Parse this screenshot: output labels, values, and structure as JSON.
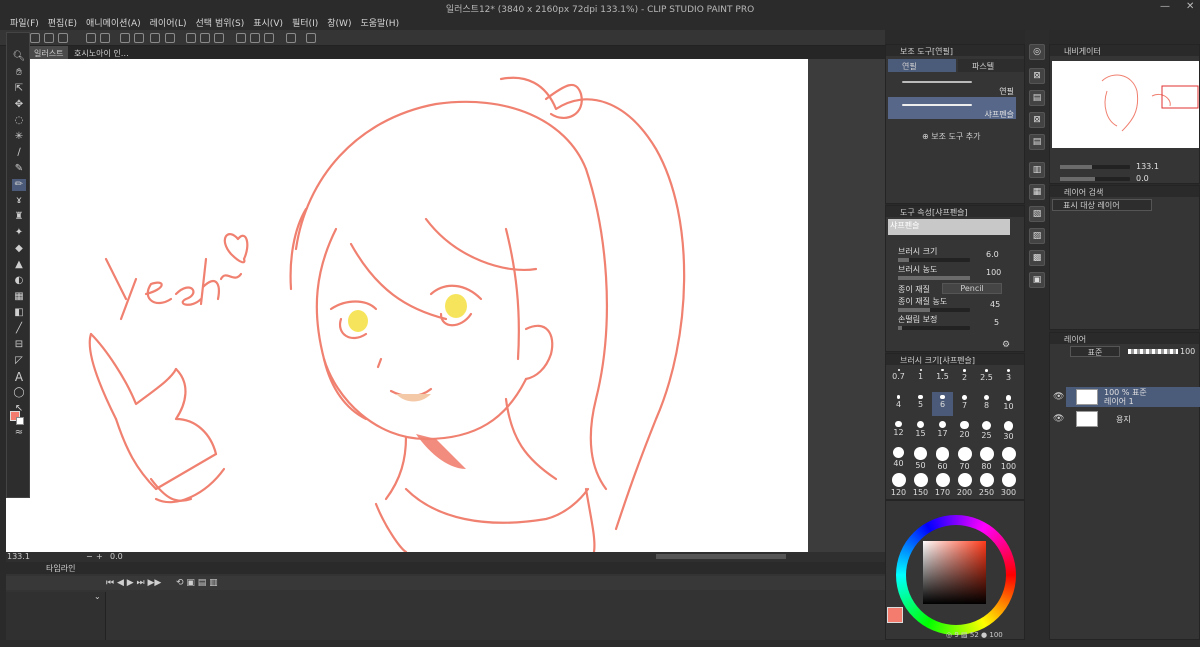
{
  "window": {
    "title": "일러스트12* (3840 x 2160px 72dpi 133.1%) - CLIP STUDIO PAINT PRO",
    "minimize": "—",
    "close": "✕"
  },
  "menu": [
    "파일(F)",
    "편집(E)",
    "애니메이션(A)",
    "레이어(L)",
    "선택 범위(S)",
    "표시(V)",
    "필터(I)",
    "창(W)",
    "도움말(H)"
  ],
  "tabs": [
    "일러스트12*",
    "호시노아이 인…"
  ],
  "canvas": {
    "text": "Yeah~",
    "line_color": "#f08070",
    "eye_color": "#f5e040",
    "skin_shade": "#f4c9a8"
  },
  "status": {
    "zoom": "133.1",
    "rotate": "0.0"
  },
  "timeline": {
    "title": "타임라인"
  },
  "subtool_panel": {
    "title": "보조 도구[연필]",
    "tab1": "연필",
    "tab2": "파스텔",
    "item1": "연필",
    "item2": "샤프펜슬",
    "add": "보조 도구 추가"
  },
  "tool_property": {
    "title": "도구 속성[샤프펜슬]",
    "name": "샤프펜슬",
    "brush_size_label": "브러시 크기",
    "brush_size": "6.0",
    "brush_size_pct": 0.15,
    "density_label": "브러시 농도",
    "density": "100",
    "density_pct": 1.0,
    "paper_label": "종이 재질",
    "paper": "Pencil",
    "paper_density_label": "종이 재질 농도",
    "paper_density": "45",
    "paper_density_pct": 0.45,
    "stabilize_label": "손떨림 보정",
    "stabilize": "5",
    "stabilize_pct": 0.05
  },
  "brush_size_panel": {
    "title": "브러시 크기[샤프펜슬]",
    "sizes": [
      "0.7",
      "1",
      "1.5",
      "2",
      "2.5",
      "3",
      "4",
      "5",
      "6",
      "7",
      "8",
      "10",
      "12",
      "15",
      "17",
      "20",
      "25",
      "30",
      "40",
      "50",
      "60",
      "70",
      "80",
      "100",
      "120",
      "150",
      "170",
      "200",
      "250",
      "300"
    ],
    "selected": "6"
  },
  "color": {
    "main": "#f47c6e",
    "sub": "#ffffff",
    "h": "9",
    "s": "52",
    "v": "100"
  },
  "navigator": {
    "title": "내비게이터",
    "zoom": "133.1",
    "angle": "0.0"
  },
  "layer_search": {
    "title": "레이어 검색",
    "filter": "표시 대상 레이어"
  },
  "layers_panel": {
    "title": "레이어",
    "blend": "표준",
    "opacity": "100",
    "layers": [
      {
        "line1": "100 % 표준",
        "line2": "레이어 1",
        "selected": true
      },
      {
        "line1": "용지",
        "line2": "",
        "selected": false
      }
    ]
  }
}
